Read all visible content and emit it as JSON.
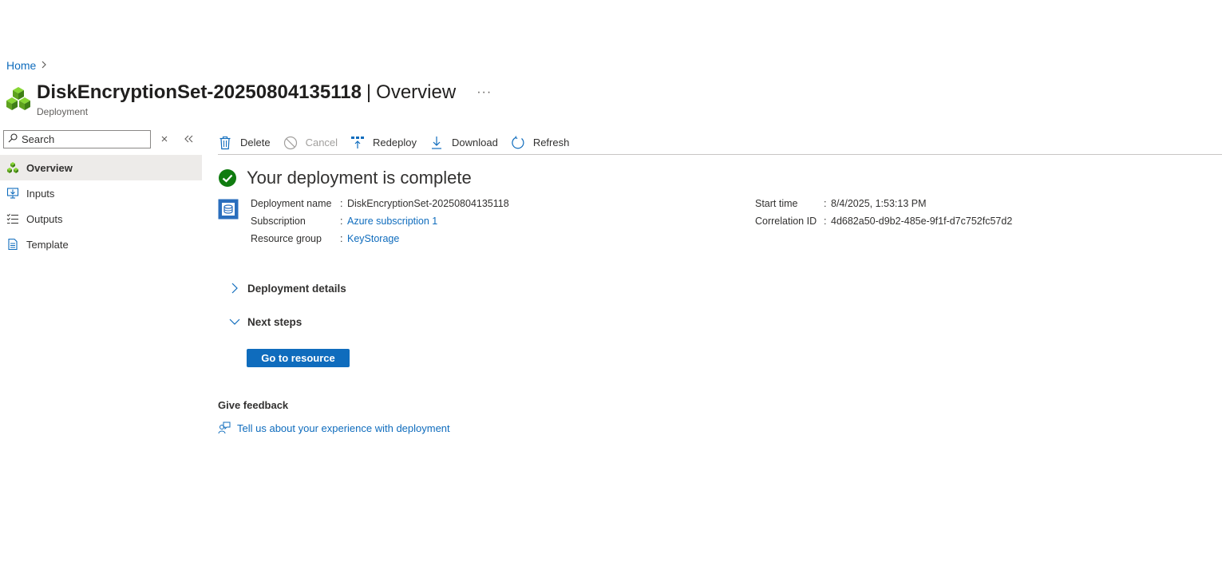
{
  "breadcrumb": {
    "home": "Home"
  },
  "header": {
    "resource_name": "DiskEncryptionSet-20250804135118",
    "separator": "|",
    "section": "Overview",
    "more": "···",
    "subtitle": "Deployment"
  },
  "sidebar": {
    "search_placeholder": "Search",
    "clear_icon": "clear-filter-icon",
    "collapse_icon": "double-chevron-left-icon",
    "items": [
      {
        "label": "Overview",
        "icon": "cubes-icon",
        "active": true
      },
      {
        "label": "Inputs",
        "icon": "monitor-input-icon",
        "active": false
      },
      {
        "label": "Outputs",
        "icon": "list-output-icon",
        "active": false
      },
      {
        "label": "Template",
        "icon": "document-icon",
        "active": false
      }
    ]
  },
  "toolbar": {
    "delete": "Delete",
    "cancel": "Cancel",
    "redeploy": "Redeploy",
    "download": "Download",
    "refresh": "Refresh"
  },
  "status": {
    "title": "Your deployment is complete",
    "color": "#107c10"
  },
  "details": {
    "deployment_name_label": "Deployment name",
    "deployment_name": "DiskEncryptionSet-20250804135118",
    "subscription_label": "Subscription",
    "subscription": "Azure subscription 1",
    "resource_group_label": "Resource group",
    "resource_group": "KeyStorage",
    "start_time_label": "Start time",
    "start_time": "8/4/2025, 1:53:13 PM",
    "correlation_label": "Correlation ID",
    "correlation_id": "4d682a50-d9b2-485e-9f1f-d7c752fc57d2",
    "colon": ":"
  },
  "sections": {
    "deployment_details": "Deployment details",
    "next_steps": "Next steps",
    "go_to_resource": "Go to resource"
  },
  "feedback": {
    "title": "Give feedback",
    "link": "Tell us about your experience with deployment"
  },
  "colors": {
    "accent": "#0f6cbd",
    "success": "#107c10"
  }
}
